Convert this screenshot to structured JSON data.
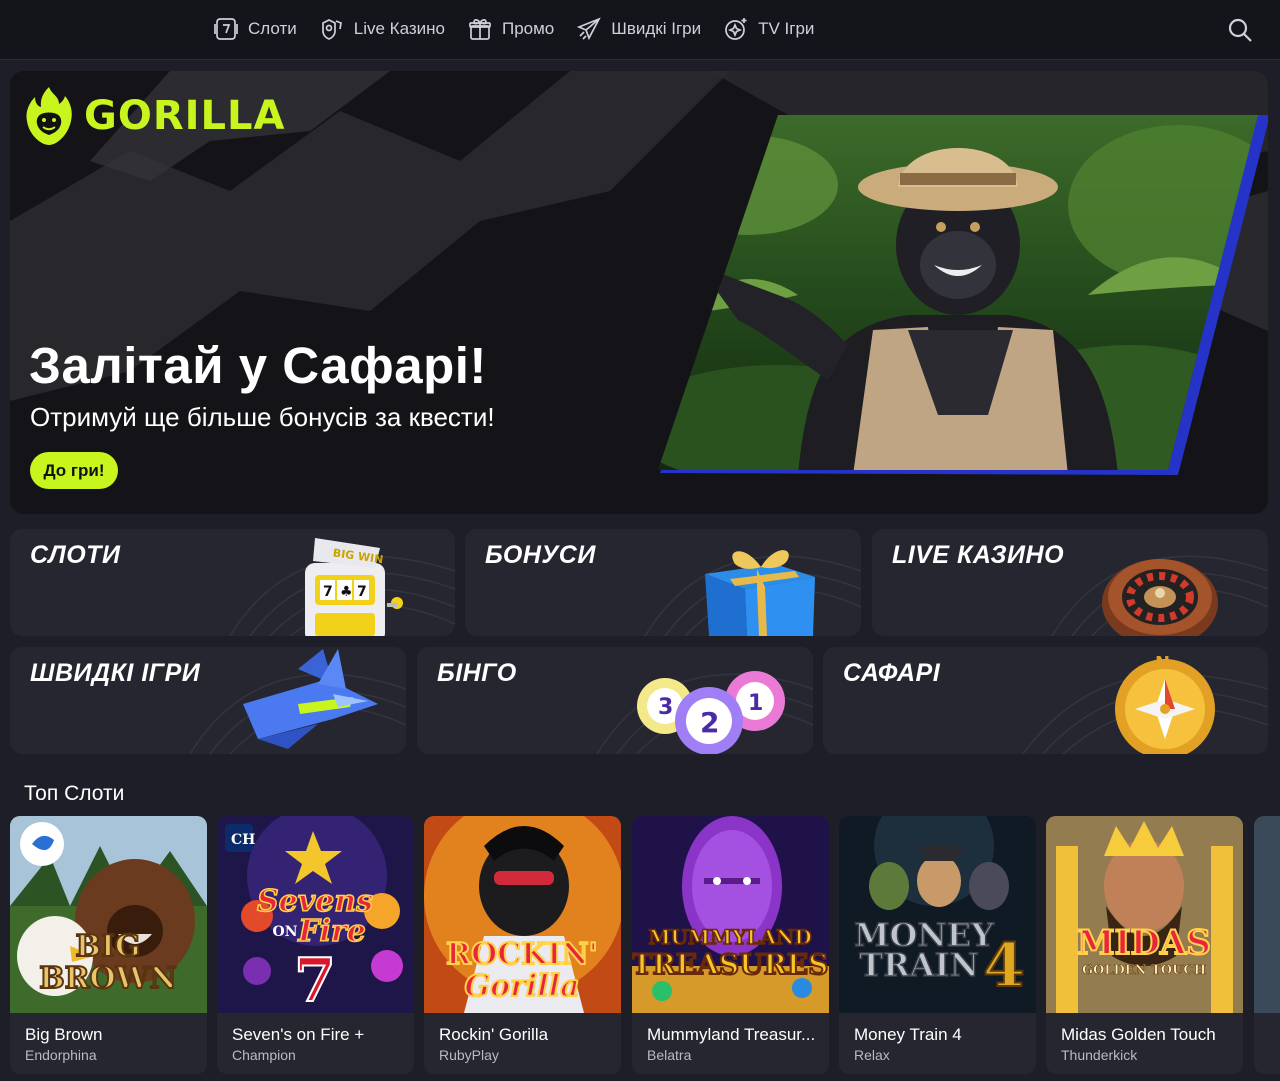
{
  "nav": {
    "items": [
      {
        "label": "Слоти",
        "icon": "slot-machine-icon"
      },
      {
        "label": "Live Казино",
        "icon": "chip-hand-icon"
      },
      {
        "label": "Промо",
        "icon": "gift-icon"
      },
      {
        "label": "Швидкі Ігри",
        "icon": "rocket-plane-icon"
      },
      {
        "label": "TV Ігри",
        "icon": "sparkle-plus-icon"
      }
    ],
    "search_icon": "search-icon"
  },
  "hero": {
    "brand": "GORILLA",
    "title": "Залітай у Сафарі!",
    "subtitle": "Отримуй ще більше бонусів за квести!",
    "button": "До гри!"
  },
  "categories": [
    {
      "label": "СЛОТИ",
      "icon": "slot-machine-icon",
      "art_text": "BIG WIN"
    },
    {
      "label": "БОНУСИ",
      "icon": "gift-box-icon"
    },
    {
      "label": "LIVE КАЗИНО",
      "icon": "roulette-icon"
    },
    {
      "label": "ШВИДКІ ІГРИ",
      "icon": "jet-icon"
    },
    {
      "label": "БІНГО",
      "icon": "bingo-balls-icon",
      "balls": [
        "3",
        "2",
        "1"
      ]
    },
    {
      "label": "САФАРІ",
      "icon": "compass-icon",
      "art_text": "N"
    }
  ],
  "top_slots": {
    "title": "Топ Слоти",
    "games": [
      {
        "title": "Big Brown",
        "provider": "Endorphina",
        "art": [
          "BIG",
          "BROWN"
        ]
      },
      {
        "title": "Seven's on Fire +",
        "provider": "Champion",
        "art": [
          "Sevens",
          "ON",
          "Fire",
          "7"
        ]
      },
      {
        "title": "Rockin' Gorilla",
        "provider": "RubyPlay",
        "art": [
          "ROCKIN'",
          "Gorilla"
        ]
      },
      {
        "title": "Mummyland Treasur...",
        "provider": "Belatra",
        "art": [
          "MUMMYLAND",
          "TREASURES"
        ]
      },
      {
        "title": "Money Train 4",
        "provider": "Relax",
        "art": [
          "MONEY",
          "TRAIN",
          "4"
        ]
      },
      {
        "title": "Midas Golden Touch",
        "provider": "Thunderkick",
        "art": [
          "MIDAS",
          "GOLDEN TOUCH"
        ]
      }
    ]
  },
  "colors": {
    "accent": "#c8f51e",
    "background": "#1e1e28",
    "panel": "#262631",
    "topbar": "#14141b"
  }
}
